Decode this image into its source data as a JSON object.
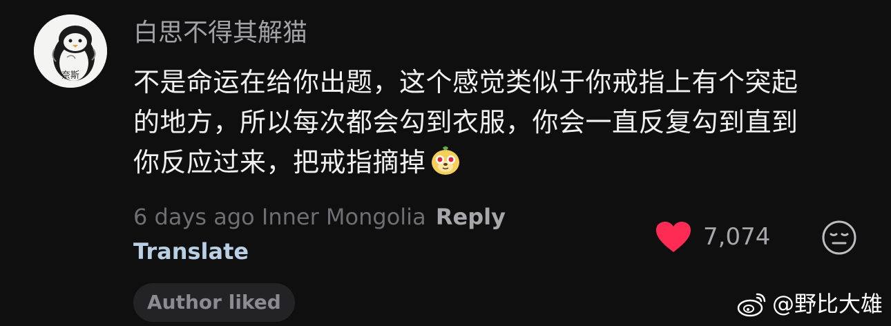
{
  "comment": {
    "avatar_text": "奈斯",
    "username": "白思不得其解猫",
    "body_lines": [
      "不是命运在给你出题，这个感觉类似于你戒指上有个突起",
      "的地方，所以每次都会勾到衣服，你会一直反复勾到直到",
      "你反应过来，把戒指摘掉"
    ],
    "emoji_icon": "dog-face-emoji-icon",
    "time": "6 days ago",
    "location": "Inner Mongolia",
    "reply_label": "Reply",
    "translate_label": "Translate",
    "like_count": "7,074",
    "heart_color": "#fe2c55",
    "author_badge": "Author liked"
  },
  "watermark": {
    "text": "@野比大雄",
    "icon": "weibo-icon"
  }
}
